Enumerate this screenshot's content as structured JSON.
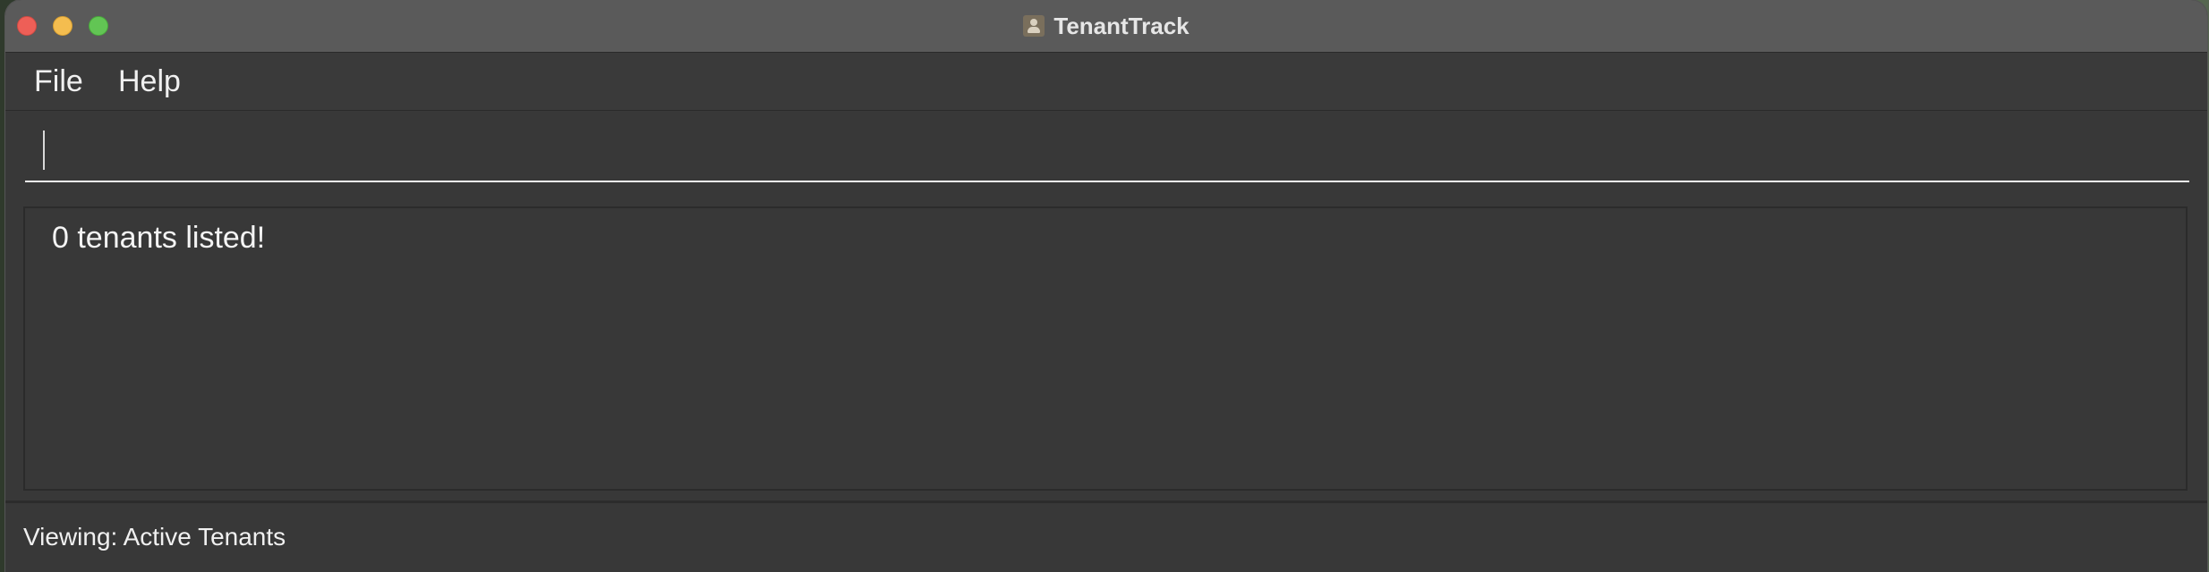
{
  "window": {
    "title": "TenantTrack",
    "app_icon": "person-card-icon"
  },
  "menu": {
    "items": [
      {
        "label": "File"
      },
      {
        "label": "Help"
      }
    ]
  },
  "command": {
    "value": "",
    "placeholder": ""
  },
  "result": {
    "message": "0 tenants listed!"
  },
  "status": {
    "text": "Viewing: Active Tenants"
  },
  "colors": {
    "close": "#ee5f57",
    "minimize": "#f4bd4f",
    "zoom": "#62c554",
    "background": "#383838",
    "titlebar": "#5a5a5a"
  }
}
